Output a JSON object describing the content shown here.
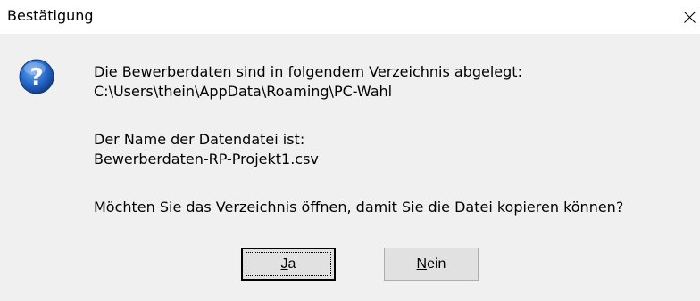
{
  "window": {
    "title": "Bestätigung"
  },
  "message": {
    "line1": "Die Bewerberdaten sind in folgendem Verzeichnis abgelegt:",
    "line2": "C:\\Users\\thein\\AppData\\Roaming\\PC-Wahl",
    "line3": "Der Name der Datendatei ist:",
    "line4": "Bewerberdaten-RP-Projekt1.csv",
    "line5": "Möchten Sie das Verzeichnis öffnen, damit Sie die Datei kopieren können?"
  },
  "buttons": {
    "yes_mnemonic": "J",
    "yes_rest": "a",
    "no_mnemonic": "N",
    "no_rest": "ein"
  },
  "icons": {
    "title_close": "close-icon",
    "message": "question-icon"
  },
  "colors": {
    "dialog_bg": "#f0f0f0",
    "titlebar_bg": "#ffffff",
    "button_bg": "#e1e1e1",
    "icon_blue": "#1f5fb8"
  }
}
